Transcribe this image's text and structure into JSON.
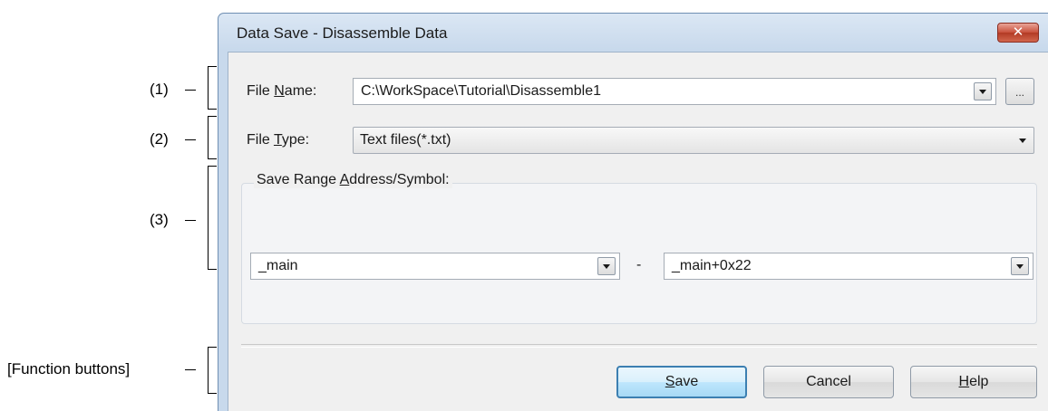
{
  "annotations": [
    {
      "label": "(1)"
    },
    {
      "label": "(2)"
    },
    {
      "label": "(3)"
    },
    {
      "label": "[Function buttons]"
    }
  ],
  "dialog": {
    "title": "Data Save - Disassemble Data",
    "close_glyph": "✕",
    "file_name": {
      "label_prefix": "File ",
      "label_mnemonic": "N",
      "label_suffix": "ame:",
      "value": "C:\\WorkSpace\\Tutorial\\Disassemble1",
      "browse_label": "..."
    },
    "file_type": {
      "label_prefix": "File ",
      "label_mnemonic": "T",
      "label_suffix": "ype:",
      "value": "Text files(*.txt)"
    },
    "save_range": {
      "title_prefix": "Save Range ",
      "title_mnemonic": "A",
      "title_suffix": "ddress/Symbol:",
      "start_value": "_main",
      "separator": "-",
      "end_value": "_main+0x22"
    },
    "buttons": {
      "save_mnemonic": "S",
      "save_rest": "ave",
      "cancel": "Cancel",
      "help_mnemonic": "H",
      "help_rest": "elp"
    }
  },
  "icons": {
    "close": "close-icon",
    "dropdown": "chevron-down-icon",
    "browse": "ellipsis-icon"
  },
  "colors": {
    "title_gradient_top": "#dbe7f4",
    "close_button": "#c8503b",
    "default_button_border": "#3c7fb1",
    "client_background": "#f0f0f0"
  }
}
